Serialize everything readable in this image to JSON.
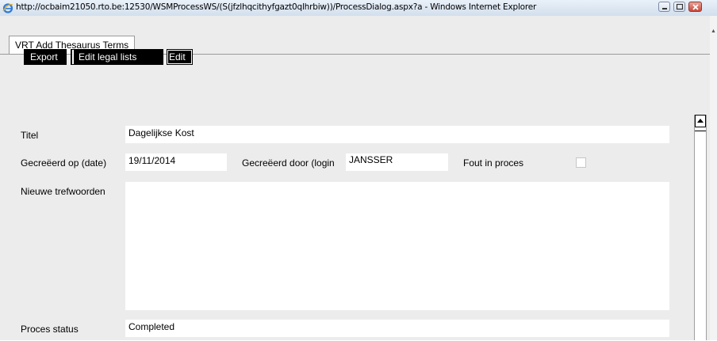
{
  "window": {
    "title": "http://ocbaim21050.rto.be:12530/WSMProcessWS/(S(jfzlhqcithyfgazt0qlhrbiw))/ProcessDialog.aspx?a - Windows Internet Explorer",
    "icon": "ie-icon",
    "controls": {
      "minimize": "minimize-icon",
      "maximize": "maximize-icon",
      "close": "close-icon"
    }
  },
  "tab": {
    "label": "VRT Add Thesaurus Terms"
  },
  "toolbar": {
    "export": "Export",
    "edit_legal_lists": "Edit legal lists",
    "edit": "Edit"
  },
  "form": {
    "titel": {
      "label": "Titel",
      "value": "Dagelijkse Kost"
    },
    "created_on": {
      "label": "Gecreëerd op (date)",
      "value": "19/11/2014"
    },
    "created_by": {
      "label": "Gecreëerd door (login",
      "value": "JANSSER"
    },
    "error": {
      "label": "Fout in proces",
      "checked": false
    },
    "keywords": {
      "label": "Nieuwe trefwoorden",
      "value": ""
    },
    "status": {
      "label": "Proces status",
      "value": "Completed"
    }
  }
}
